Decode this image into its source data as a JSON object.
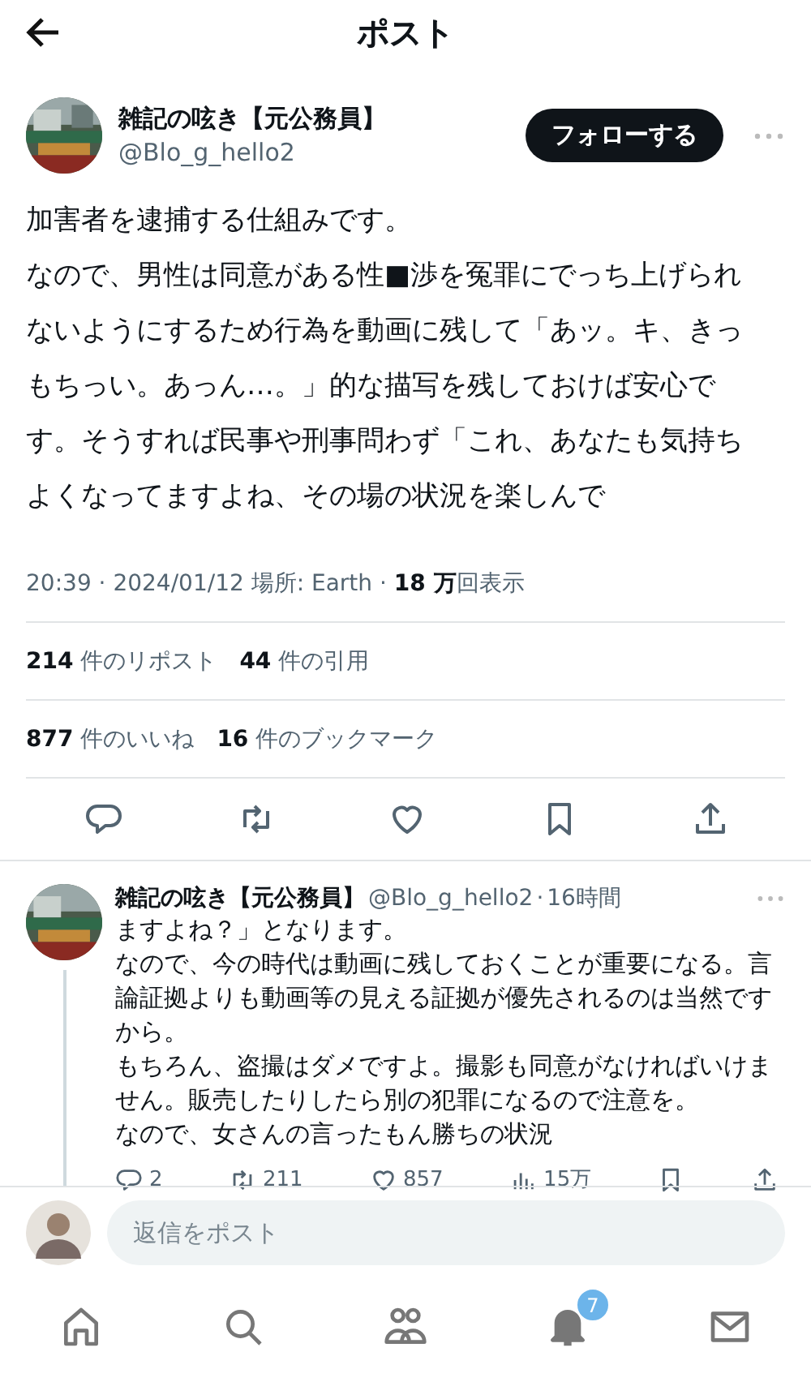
{
  "header": {
    "title": "ポスト"
  },
  "post": {
    "author": {
      "name": "雑記の呟き【元公務員】",
      "handle": "@Blo_g_hello2"
    },
    "follow_button": "フォローする",
    "paragraphs": [
      "加害者を逮捕する仕組みです。",
      "なので、男性は同意がある性■渉を冤罪にでっち上げられないようにするため行為を動画に残して「あッ。キ、きっもちっい。あっん…。」的な描写を残しておけば安心です。そうすれば民事や刑事問わず「これ、あなたも気持ちよくなってますよね、その場の状況を楽しんで"
    ],
    "meta": "20:39 · 2024/01/12  場所: Earth · **18 万**回表示",
    "stats": [
      [
        "**214** 件のリポスト",
        "**44** 件の引用"
      ],
      [
        "**877** 件のいいね",
        "**16** 件のブックマーク"
      ]
    ],
    "actions": [
      {
        "kind": "reply"
      },
      {
        "kind": "repost"
      },
      {
        "kind": "like"
      },
      {
        "kind": "bookmark"
      },
      {
        "kind": "share"
      }
    ]
  },
  "reply": {
    "name": "雑記の呟き【元公務員】",
    "handle": "@Blo_g_hello2",
    "separator": "·",
    "time": "16時間",
    "lines": [
      "ますよね？」となります。",
      "なので、今の時代は動画に残しておくことが重要になる。言論証拠よりも動画等の見える証拠が優先されるのは当然ですから。",
      "もちろん、盗撮はダメですよ。撮影も同意がなければいけません。販売したりしたら別の犯罪になるので注意を。",
      "なので、女さんの言ったもん勝ちの状況"
    ],
    "actions": [
      {
        "kind": "reply",
        "count": "2"
      },
      {
        "kind": "repost",
        "count": "211"
      },
      {
        "kind": "like",
        "count": "857"
      },
      {
        "kind": "views",
        "count": "15万"
      },
      {
        "kind": "bookmark"
      },
      {
        "kind": "share"
      }
    ]
  },
  "composer": {
    "placeholder": "返信をポスト"
  },
  "tabbar": [
    {
      "kind": "home"
    },
    {
      "kind": "search"
    },
    {
      "kind": "communities"
    },
    {
      "kind": "notifications",
      "badge": "7"
    },
    {
      "kind": "messages"
    }
  ]
}
